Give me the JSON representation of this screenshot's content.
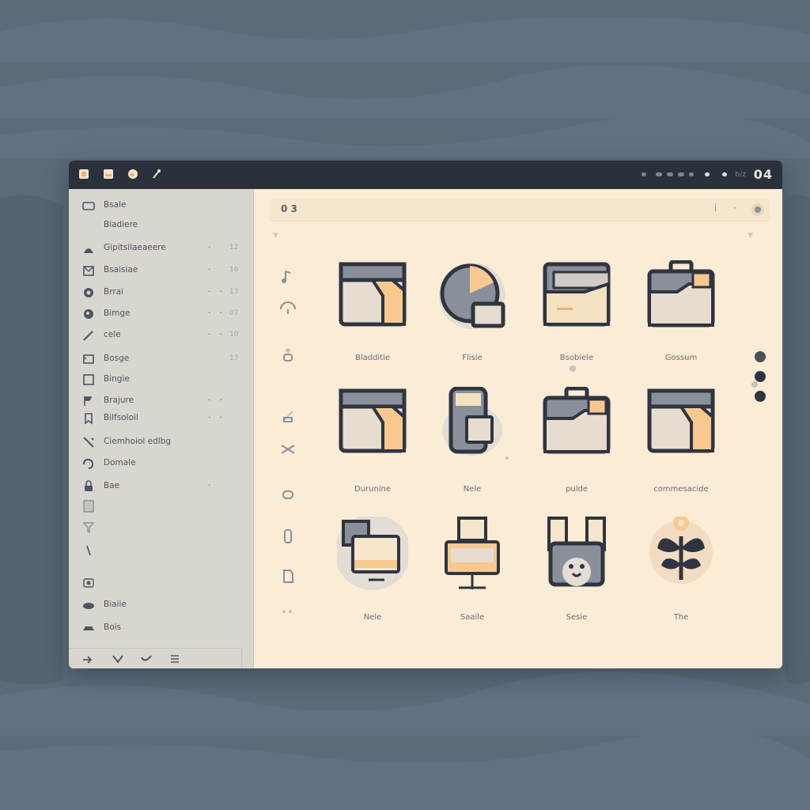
{
  "titlebar": {
    "clock": "04",
    "dim_label": "b/z"
  },
  "toolbar": {
    "left_text": "0 3"
  },
  "sidebar": {
    "items": [
      {
        "label": "Bsale",
        "icon": "drive-icon",
        "num": "",
        "dots": ""
      },
      {
        "label": "Biadiere",
        "icon": "",
        "num": "",
        "dots": ""
      },
      {
        "label": "Gipitsilaeaeere",
        "icon": "user-icon",
        "num": "12",
        "dots": "·"
      },
      {
        "label": "Bsaisiae",
        "icon": "document-icon",
        "num": "16",
        "dots": "·"
      },
      {
        "label": "Brrai",
        "icon": "mail-icon",
        "num": "13",
        "dots": "· ·"
      },
      {
        "label": "Bimge",
        "icon": "globe-icon",
        "num": "07",
        "dots": "· ·"
      },
      {
        "label": "cele",
        "icon": "pen-icon",
        "num": "10",
        "dots": "· ·"
      },
      {
        "label": "Bosge",
        "icon": "image-icon",
        "num": "13",
        "dots": ""
      },
      {
        "label": "Bingie",
        "icon": "square-icon",
        "num": "",
        "dots": ""
      },
      {
        "label": "Brajure",
        "icon": "flag-icon",
        "num": "",
        "dots": "· ·"
      },
      {
        "label": "Bilfsoloil",
        "icon": "bookmark-icon",
        "num": "",
        "dots": "· ·"
      },
      {
        "label": "Ciemhoiol edlbg",
        "icon": "tool-icon",
        "num": "",
        "dots": ""
      },
      {
        "label": "Domale",
        "icon": "sound-icon",
        "num": "",
        "dots": ""
      },
      {
        "label": "Bae",
        "icon": "lock-icon",
        "num": "",
        "dots": "·"
      },
      {
        "label": "",
        "icon": "file-icon",
        "num": "",
        "dots": ""
      },
      {
        "label": "",
        "icon": "funnel-icon",
        "num": "",
        "dots": ""
      },
      {
        "label": "",
        "icon": "cursor-icon",
        "num": "",
        "dots": ""
      },
      {
        "label": "",
        "icon": "camera-icon",
        "num": "",
        "dots": ""
      },
      {
        "label": "Biaiie",
        "icon": "cloud-icon",
        "num": "",
        "dots": ""
      },
      {
        "label": "Bois",
        "icon": "car-icon",
        "num": "",
        "dots": ""
      }
    ]
  },
  "grid": {
    "tiles": [
      {
        "label": "Bladditie",
        "icon": "folder-icon"
      },
      {
        "label": "Flisie",
        "icon": "disk-icon"
      },
      {
        "label": "Bsobiele",
        "icon": "folder-stack-icon"
      },
      {
        "label": "Gossum",
        "icon": "briefcase-icon"
      },
      {
        "label": "Durunine",
        "icon": "folder-icon"
      },
      {
        "label": "Nele",
        "icon": "database-icon"
      },
      {
        "label": "pulde",
        "icon": "briefcase-icon"
      },
      {
        "label": "commesacide",
        "icon": "folder-icon"
      },
      {
        "label": "Nele",
        "icon": "monitor-icon"
      },
      {
        "label": "Saaile",
        "icon": "easel-icon"
      },
      {
        "label": "Sesie",
        "icon": "animal-icon"
      },
      {
        "label": "The",
        "icon": "plant-icon"
      }
    ]
  },
  "colors": {
    "accent": "#f8c88f",
    "dark": "#2f3540",
    "gray": "#8a9099",
    "paper": "#fbecd5"
  }
}
